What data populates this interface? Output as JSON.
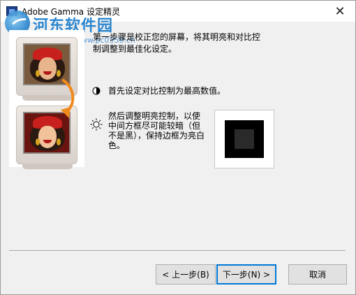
{
  "window": {
    "title": "Adobe Gamma 设定精灵",
    "close_glyph": "✕"
  },
  "watermark": {
    "brand": "河东软件园",
    "url": "www.pc0359.cn"
  },
  "instructions": {
    "step1": "第一步骤是校正您的屏幕，将其明亮和对比控制调整到最佳化设定。",
    "contrast": "首先设定对比控制为最高数值。",
    "brightness": "然后调整明亮控制，以使中间方框尽可能较暗（但不是黑），保持边框为亮白色。"
  },
  "buttons": {
    "back": "< 上一步(B)",
    "next": "下一步(N) >",
    "cancel": "取消"
  },
  "colors": {
    "accent": "#0078d7",
    "arrow": "#f08a1c"
  }
}
